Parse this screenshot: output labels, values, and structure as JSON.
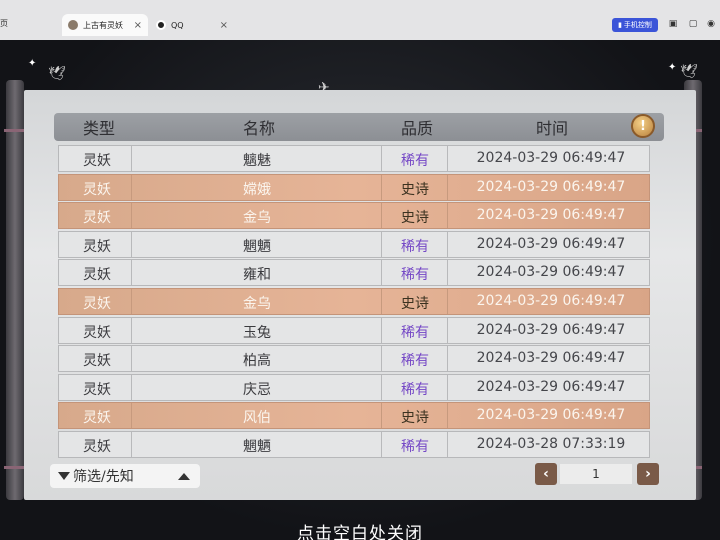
{
  "browser": {
    "partial_tab_text": "页",
    "tabs": [
      {
        "label": "上古有灵妖",
        "close": "×"
      },
      {
        "label": "QQ",
        "close": "×"
      }
    ],
    "mobile_button": "手机控制"
  },
  "table": {
    "headers": {
      "type": "类型",
      "name": "名称",
      "quality": "品质",
      "time": "时间"
    },
    "info_icon": "!",
    "rows": [
      {
        "type": "灵妖",
        "name": "魑魅",
        "quality": "稀有",
        "time": "2024-03-29  06:49:47",
        "tier": "rare"
      },
      {
        "type": "灵妖",
        "name": "嫦娥",
        "quality": "史诗",
        "time": "2024-03-29  06:49:47",
        "tier": "epic"
      },
      {
        "type": "灵妖",
        "name": "金乌",
        "quality": "史诗",
        "time": "2024-03-29  06:49:47",
        "tier": "epic"
      },
      {
        "type": "灵妖",
        "name": "魍魉",
        "quality": "稀有",
        "time": "2024-03-29  06:49:47",
        "tier": "rare"
      },
      {
        "type": "灵妖",
        "name": "雍和",
        "quality": "稀有",
        "time": "2024-03-29  06:49:47",
        "tier": "rare"
      },
      {
        "type": "灵妖",
        "name": "金乌",
        "quality": "史诗",
        "time": "2024-03-29  06:49:47",
        "tier": "epic"
      },
      {
        "type": "灵妖",
        "name": "玉兔",
        "quality": "稀有",
        "time": "2024-03-29  06:49:47",
        "tier": "rare"
      },
      {
        "type": "灵妖",
        "name": "柏高",
        "quality": "稀有",
        "time": "2024-03-29  06:49:47",
        "tier": "rare"
      },
      {
        "type": "灵妖",
        "name": "庆忌",
        "quality": "稀有",
        "time": "2024-03-29  06:49:47",
        "tier": "rare"
      },
      {
        "type": "灵妖",
        "name": "风伯",
        "quality": "史诗",
        "time": "2024-03-29  06:49:47",
        "tier": "epic"
      },
      {
        "type": "灵妖",
        "name": "魍魉",
        "quality": "稀有",
        "time": "2024-03-28  07:33:19",
        "tier": "rare"
      }
    ]
  },
  "filter": {
    "label": "筛选/先知"
  },
  "pager": {
    "prev": "‹",
    "next": "›",
    "page": "1"
  },
  "footer": {
    "close_hint": "点击空白处关闭"
  },
  "colors": {
    "rare_text": "#7548c6",
    "epic_row": "#e6b497",
    "mobile_button": "#3b54d8"
  }
}
